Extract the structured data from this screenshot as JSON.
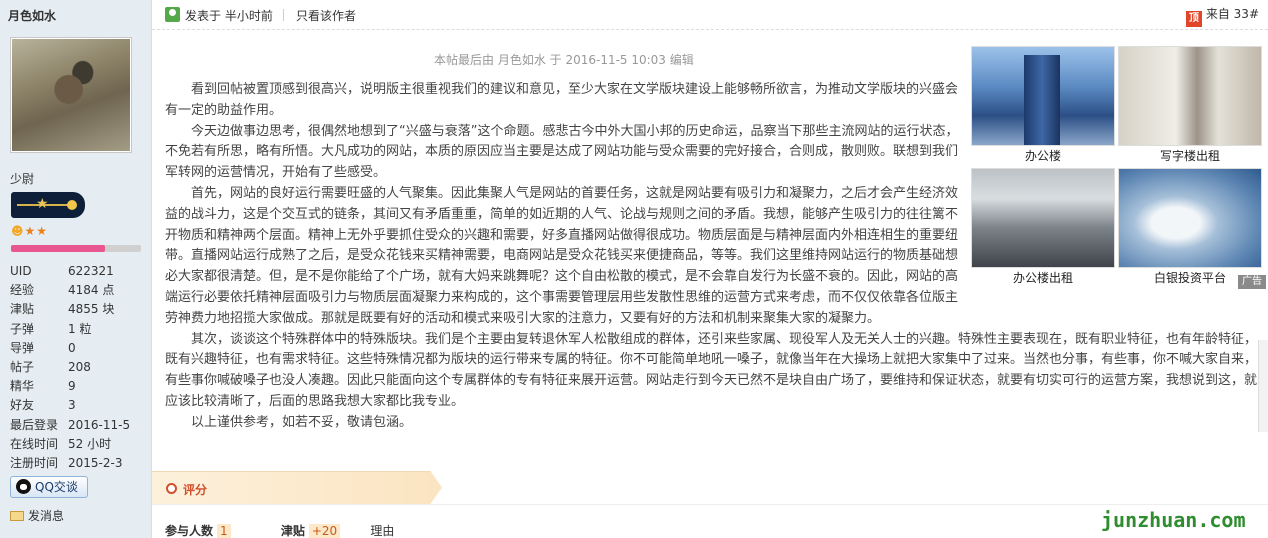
{
  "user": {
    "name": "月色如水",
    "rank_title": "少尉",
    "stats": [
      {
        "k": "UID",
        "v": "622321"
      },
      {
        "k": "经验",
        "v": "4184 点"
      },
      {
        "k": "津贴",
        "v": "4855 块"
      },
      {
        "k": "子弹",
        "v": "1 粒"
      },
      {
        "k": "导弹",
        "v": "0"
      },
      {
        "k": "帖子",
        "v": "208"
      },
      {
        "k": "精华",
        "v": "9"
      },
      {
        "k": "好友",
        "v": "3"
      },
      {
        "k": "最后登录",
        "v": "2016-11-5"
      },
      {
        "k": "在线时间",
        "v": "52 小时"
      },
      {
        "k": "注册时间",
        "v": "2015-2-3"
      }
    ],
    "level_progress": 0.72,
    "qq_label": "QQ交谈",
    "message_label": "发消息"
  },
  "post": {
    "posted_at": "发表于 半小时前",
    "only_author": "只看该作者",
    "floor": "来自 33#",
    "floor_tag": "顶",
    "edit_note": "本帖最后由 月色如水 于 2016-11-5 10:03 编辑",
    "paragraphs": [
      "看到回帖被置顶感到很高兴，说明版主很重视我们的建议和意见，至少大家在文学版块建设上能够畅所欲言，为推动文学版块的兴盛会有一定的助益作用。",
      "今天边做事边思考，很偶然地想到了“兴盛与衰落”这个命题。感悲古今中外大国小邦的历史命运，品察当下那些主流网站的运行状态，不免若有所思，略有所悟。大凡成功的网站，本质的原因应当主要是达成了网站功能与受众需要的完好接合，合则成，散则败。联想到我们军转网的运营情况，开始有了些感受。",
      "首先，网站的良好运行需要旺盛的人气聚集。因此集聚人气是网站的首要任务，这就是网站要有吸引力和凝聚力，之后才会产生经济效益的战斗力，这是个交互式的链条，其间又有矛盾重重，简单的如近期的人气、论战与规则之间的矛盾。我想，能够产生吸引力的往往篱不开物质和精神两个层面。精神上无外乎要抓住受众的兴趣和需要，好多直播网站做得很成功。物质层面是与精神层面内外相连相生的重要纽带。直播网站运行成熟了之后，是受众花钱来买精神需要，电商网站是受众花钱买来便捷商品，等等。我们这里维持网站运行的物质基础想必大家都很清楚。但，是不是你能给了个广场，就有大妈来跳舞呢？这个自由松散的模式，是不会靠自发行为长盛不衰的。因此，网站的高端运行必要依托精神层面吸引力与物质层面凝聚力来构成的，这个事需要管理层用些发散性思维的运营方式来考虑，而不仅仅依靠各位版主劳神费力地招揽大家做成。那就是既要有好的活动和模式来吸引大家的注意力，又要有好的方法和机制来聚集大家的凝聚力。",
      "其次，谈谈这个特殊群体中的特殊版块。我们是个主要由复转退休军人松散组成的群体，还引来些家属、现役军人及无关人士的兴趣。特殊性主要表现在，既有职业特征，也有年龄特征，既有兴趣特征，也有需求特征。这些特殊情况都为版块的运行带来专属的特征。你不可能简单地吼一嗓子，就像当年在大操场上就把大家集中了过来。当然也分事，有些事，你不喊大家自来，有些事你喊破嗓子也没人凑趣。因此只能面向这个专属群体的专有特征来展开运营。网站走行到今天已然不是块自由广场了，要维持和保证状态，就要有切实可行的运营方案，我想说到这，就应该比较清晰了，后面的思路我想大家都比我专业。",
      "以上谨供参考，如若不妥，敬请包涵。"
    ]
  },
  "ad": {
    "items": [
      {
        "caption": "办公楼"
      },
      {
        "caption": "写字楼出租"
      },
      {
        "caption": "办公楼出租"
      },
      {
        "caption": "白银投资平台"
      }
    ],
    "tag": "广告"
  },
  "rating": {
    "label": "评分",
    "participants_label": "参与人数",
    "participants": "1",
    "allowance_label": "津贴",
    "allowance": "+20",
    "reason_label": "理由"
  },
  "watermark": "junzhuan.com"
}
